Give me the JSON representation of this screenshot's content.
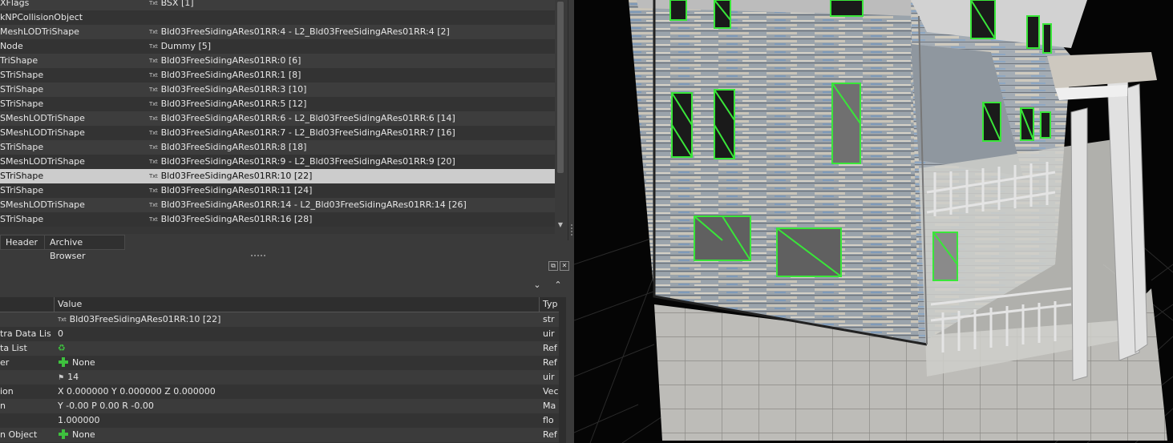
{
  "tree": {
    "rows": [
      {
        "type": "XFlags",
        "value": "BSX [1]",
        "txt": true
      },
      {
        "type": "kNPCollisionObject",
        "value": "",
        "txt": false
      },
      {
        "type": "MeshLODTriShape",
        "value": "Bld03FreeSidingARes01RR:4 - L2_Bld03FreeSidingARes01RR:4 [2]",
        "txt": true
      },
      {
        "type": "Node",
        "value": "Dummy [5]",
        "txt": true
      },
      {
        "type": "TriShape",
        "value": "Bld03FreeSidingARes01RR:0 [6]",
        "txt": true
      },
      {
        "type": "STriShape",
        "value": "Bld03FreeSidingARes01RR:1 [8]",
        "txt": true
      },
      {
        "type": "STriShape",
        "value": "Bld03FreeSidingARes01RR:3 [10]",
        "txt": true
      },
      {
        "type": "STriShape",
        "value": "Bld03FreeSidingARes01RR:5 [12]",
        "txt": true
      },
      {
        "type": "SMeshLODTriShape",
        "value": "Bld03FreeSidingARes01RR:6 - L2_Bld03FreeSidingARes01RR:6 [14]",
        "txt": true
      },
      {
        "type": "SMeshLODTriShape",
        "value": "Bld03FreeSidingARes01RR:7 - L2_Bld03FreeSidingARes01RR:7 [16]",
        "txt": true
      },
      {
        "type": "STriShape",
        "value": "Bld03FreeSidingARes01RR:8 [18]",
        "txt": true
      },
      {
        "type": "SMeshLODTriShape",
        "value": "Bld03FreeSidingARes01RR:9 - L2_Bld03FreeSidingARes01RR:9 [20]",
        "txt": true
      },
      {
        "type": "STriShape",
        "value": "Bld03FreeSidingARes01RR:10 [22]",
        "txt": true,
        "selected": true
      },
      {
        "type": "STriShape",
        "value": "Bld03FreeSidingARes01RR:11 [24]",
        "txt": true
      },
      {
        "type": "SMeshLODTriShape",
        "value": "Bld03FreeSidingARes01RR:14 - L2_Bld03FreeSidingARes01RR:14 [26]",
        "txt": true
      },
      {
        "type": "STriShape",
        "value": "Bld03FreeSidingARes01RR:16 [28]",
        "txt": true
      }
    ],
    "txt_icon": "Txt"
  },
  "tabs": [
    {
      "label": "Header"
    },
    {
      "label": "Archive Browser"
    }
  ],
  "props": {
    "columns": [
      "Value",
      "Typ"
    ],
    "rows": [
      {
        "name": "",
        "icon": "txt",
        "value": "Bld03FreeSidingARes01RR:10 [22]",
        "type": "str"
      },
      {
        "name": "tra Data List",
        "icon": "",
        "value": "0",
        "type": "uir"
      },
      {
        "name": "ta List",
        "icon": "recycle",
        "value": "",
        "type": "Ref"
      },
      {
        "name": "er",
        "icon": "plus",
        "value": "None",
        "type": "Ref"
      },
      {
        "name": "",
        "icon": "flag",
        "value": "14",
        "type": "uir"
      },
      {
        "name": "ion",
        "icon": "",
        "value": "X 0.000000 Y 0.000000 Z 0.000000",
        "type": "Vec"
      },
      {
        "name": "n",
        "icon": "",
        "value": "Y -0.00 P 0.00 R -0.00",
        "type": "Ma"
      },
      {
        "name": "",
        "icon": "",
        "value": "1.000000",
        "type": "flo"
      },
      {
        "name": "n Object",
        "icon": "plus",
        "value": "None",
        "type": "Ref"
      }
    ]
  },
  "colors": {
    "selection": "#cccccc",
    "wireframe": "#39e639",
    "siding": "#8f9aa6"
  }
}
